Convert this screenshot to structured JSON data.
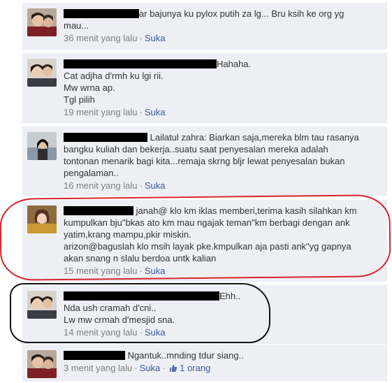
{
  "comments": [
    {
      "redacted_name": true,
      "lines": [
        "ar bajunya ku pylox putih za lg... Bru ksih ke org yg",
        "mau..."
      ],
      "time": "36 menit yang lalu",
      "like": "Suka"
    },
    {
      "redacted_name": true,
      "lines": [
        "Hahaha.",
        "Cat adjha d'rmh ku lgi rii.",
        "Mw wrna ap.",
        "Tgl pilih"
      ],
      "time": "19 menit yang lalu",
      "like": "Suka"
    },
    {
      "redacted_name": true,
      "lines": [
        "Lailatul zahra: Biarkan saja,mereka blm tau rasanya",
        "bangku kuliah dan bekerja..suatu saat penyesalan mereka adalah",
        "tontonan menarik bagi kita...remaja skrng bljr lewat penyesalan bukan",
        "pengalaman.."
      ],
      "time": "16 menit yang lalu",
      "like": "Suka"
    },
    {
      "redacted_name": true,
      "lines": [
        "janah@ klo km iklas memberi,terima kasih silahkan km",
        "kumpulkan bju\"bkas ato km mau ngajak teman\"km berbagi dengan ank",
        "yatim,krang mampu,pkir miskin.",
        "arizon@baguslah klo msih layak pke.kmpulkan aja pasti ank\"yg gapnya",
        "akan snang n slalu berdoa untk kalian"
      ],
      "time": "15 menit yang lalu",
      "like": "Suka"
    },
    {
      "redacted_name": true,
      "lines": [
        "Ehh..",
        "Nda ush cramah d'cni..",
        "Lw mw crmah d'mesjid sna."
      ],
      "time": "14 menit yang lalu",
      "like": "Suka"
    },
    {
      "redacted_name": true,
      "lines": [
        "Ngantuk..mnding tdur siang.."
      ],
      "time": "3 menit yang lalu",
      "like": "Suka",
      "like_count": "1 orang"
    }
  ]
}
